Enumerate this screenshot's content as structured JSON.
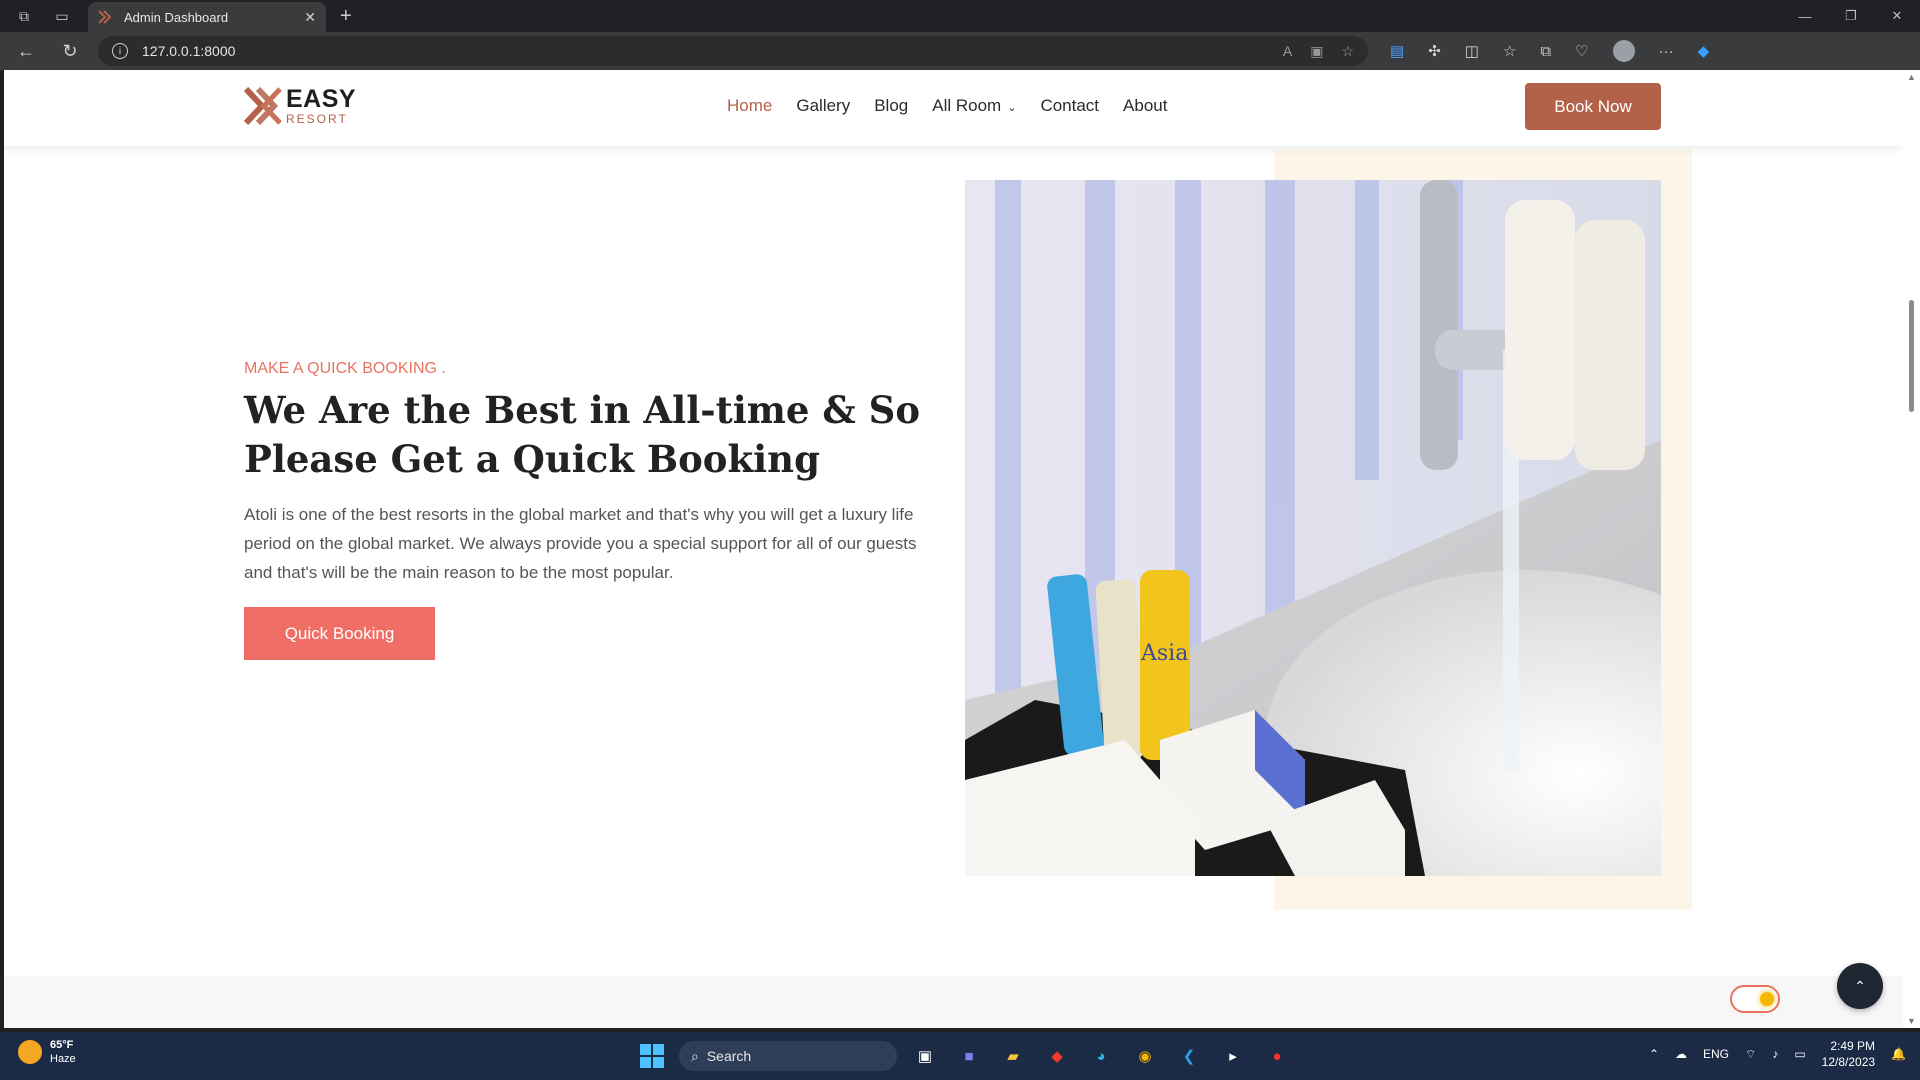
{
  "browser": {
    "tab_title": "Admin Dashboard",
    "url": "127.0.0.1:8000"
  },
  "site": {
    "logo_main": "EASY",
    "logo_sub": "RESORT",
    "nav": [
      "Home",
      "Gallery",
      "Blog",
      "All Room",
      "Contact",
      "About"
    ],
    "active_nav": "Home",
    "book_now": "Book Now",
    "colors": {
      "accent": "#b4614a",
      "coral": "#ef6f66",
      "beige": "#fdf6e8"
    }
  },
  "hero": {
    "kicker": "MAKE A QUICK BOOKING .",
    "heading": "We Are the Best in All-time & So Please Get a Quick Booking",
    "paragraph": "Atoli is one of the best resorts in the global market and that's why you will get a luxury life period on the global market. We always provide you a special support for all of our guests and that's will be the main reason to be the most popular.",
    "button": "Quick Booking",
    "image_text": [
      "Asia"
    ]
  },
  "taskbar": {
    "weather_temp": "65°F",
    "weather_desc": "Haze",
    "search": "Search",
    "lang": "ENG",
    "time": "2:49 PM",
    "date": "12/8/2023"
  }
}
